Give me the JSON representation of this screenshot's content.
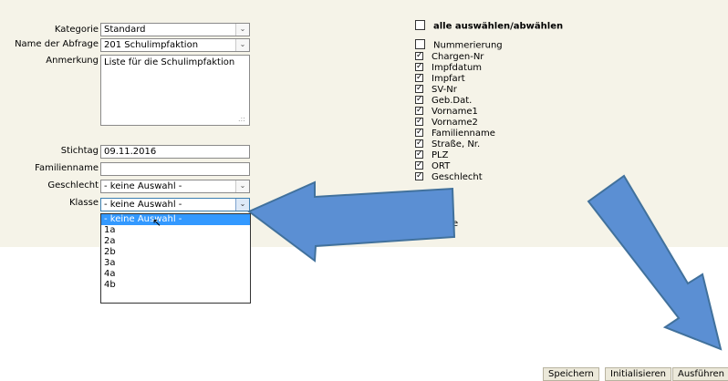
{
  "form": {
    "kategorie_label": "Kategorie",
    "kategorie_value": "Standard",
    "abfrage_label": "Name der Abfrage",
    "abfrage_value": "201 Schulimpfaktion",
    "anmerkung_label": "Anmerkung",
    "anmerkung_value": "Liste für die Schulimpfaktion",
    "stichtag_label": "Stichtag",
    "stichtag_value": "09.11.2016",
    "familienname_label": "Familienname",
    "familienname_value": "",
    "geschlecht_label": "Geschlecht",
    "geschlecht_value": "- keine Auswahl -",
    "klasse_label": "Klasse",
    "klasse_value": "- keine Auswahl -"
  },
  "klasse_options": [
    "- keine Auswahl -",
    "1a",
    "2a",
    "2b",
    "3a",
    "4a",
    "4b"
  ],
  "select_all_label": "alle auswählen/abwählen",
  "columns": [
    {
      "label": "Nummerierung",
      "checked": false
    },
    {
      "label": "Chargen-Nr",
      "checked": true
    },
    {
      "label": "Impfdatum",
      "checked": true
    },
    {
      "label": "Impfart",
      "checked": true
    },
    {
      "label": "SV-Nr",
      "checked": true
    },
    {
      "label": "Geb.Dat.",
      "checked": true
    },
    {
      "label": "Vorname1",
      "checked": true
    },
    {
      "label": "Vorname2",
      "checked": true
    },
    {
      "label": "Familienname",
      "checked": true
    },
    {
      "label": "Straße, Nr.",
      "checked": true
    },
    {
      "label": "PLZ",
      "checked": true
    },
    {
      "label": "ORT",
      "checked": true
    },
    {
      "label": "Geschlecht",
      "checked": true
    }
  ],
  "hidden_fragment": "e",
  "buttons": {
    "save": "Speichern",
    "init": "Initialisieren",
    "run": "Ausführen"
  },
  "colors": {
    "panel": "#f5f3e8",
    "arrow_fill": "#5b8fd3",
    "arrow_stroke": "#41719c",
    "selected_option": "#3399ff"
  }
}
